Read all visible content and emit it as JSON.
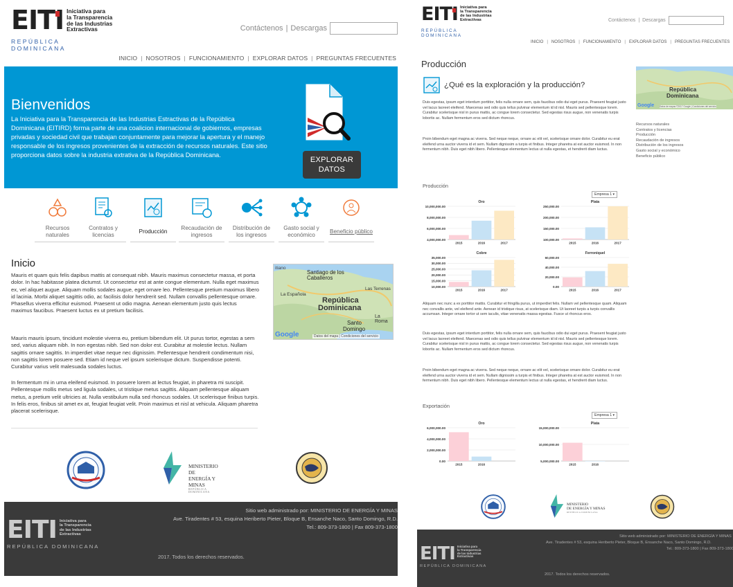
{
  "colors": {
    "hero": "#0097d4",
    "flag_red": "#d02b2b",
    "flag_blue": "#2f5fa8",
    "footer": "#3a3a3a"
  },
  "logo": {
    "big": "EITI",
    "small": [
      "Iniciativa para",
      "la Transparencia",
      "de las Industrias",
      "Extractivas"
    ],
    "country": "REPÚBLICA DOMINICANA"
  },
  "header": {
    "contact": "Contáctenos",
    "separator": "|",
    "downloads": "Descargas"
  },
  "nav": [
    "INICIO",
    "NOSOTROS",
    "FUNCIONAMIENTO",
    "EXPLORAR DATOS",
    "PREGUNTAS FRECUENTES"
  ],
  "hero": {
    "title": "Bienvenidos",
    "text": "La Iniciativa para la Transparencia de las Industrias Estractivas de la República Dominicana (EITIRD) forma parte de una coalicion internacional de gobiernos, empresas privadas y sociedad civil que trabajan conjuntamente para mejorar la apertura y el manejo responsable de los ingresos provenientes de la extracción de recursos naturales. Este sitio proporciona datos sobre la industria extrativa de la República Dominicana.",
    "button": [
      "EXPLORAR",
      "DATOS"
    ],
    "icon": "document-search-icon"
  },
  "categories": [
    {
      "label": "Recursos naturales",
      "icon": "minerals-icon"
    },
    {
      "label": "Contratos y licencias",
      "icon": "contract-icon"
    },
    {
      "label": "Producción",
      "icon": "production-icon"
    },
    {
      "label": "Recaudación de ingresos",
      "icon": "revenue-icon"
    },
    {
      "label": "Distribución de los ingresos",
      "icon": "distribution-icon"
    },
    {
      "label": "Gasto social y económico",
      "icon": "social-spending-icon"
    },
    {
      "label": "Beneficio público",
      "icon": "public-benefit-icon"
    }
  ],
  "inicio": {
    "title": "Inicio",
    "paragraphs": [
      "Mauris et quam quis felis dapibus mattis at consequat nibh. Mauris maximus consectetur massa, et porta dolor. In hac habitasse platea dictumst. Ut consectetur est at ante congue elementum. Nulla eget maximus ex, vel aliquet augue. Aliquam mollis sodales augue, eget ornare leo. Pellentesque pretium maximus libero id lacinia. Morbi aliquet sagittis odio, ac facilisis dolor hendrerit sed. Nullam convallis pellentesque ornare. Phasellus viverra efficitur euismod. Praesent ut odio magna. Aenean elementum justo quis lectus maximus faucibus. Praesent luctus ex ut pretium facilisis.",
      "Mauris mauris ipsum, tincidunt molestie viverra eu, pretium bibendum elit. Ut purus tortor, egestas a sem sed, varius aliquam nibh. In non egestas nibh. Sed non dolor est. Curabitur at molestie lectus. Nullam sagittis ornare sagittis. In imperdiet vitae neque nec dignissim. Pellentesque hendrerit condimentum nisi, non sagittis lorem posuere sed. Etiam id neque vel ipsum scelerisque dictum. Suspendisse potenti. Curabitur varius velit malesuada sodales luctus.",
      "In fermentum mi in urna eleifend euismod. In posuere lorem at lectus feugiat, in pharetra mi suscipit. Pellentesque mollis metus sed ligula sodales, ut tristique metus sagittis. Aliquam pellentesque aliquam metus, a pretium velit ultricies at. Nulla vestibulum nulla sed rhoncus sodales. Ut scelerisque finibus turpis. In felis eros, finibus sit amet ex at, feugiat feugiat velit. Proin maximus et nisl at vehicula. Aliquam pharetra placerat scelerisque."
    ]
  },
  "map": {
    "labels": [
      "Santiago de los Caballeros",
      "Las Terrenas",
      "La Española",
      "República",
      "Dominicana",
      "Santo",
      "Domingo",
      "La Roma"
    ],
    "google": "Google",
    "footer": "Datos del mapa  |  Condiciones del servicio",
    "footer_small": "Datos de mapas ©2017 Google  |  Condiciones del servicio"
  },
  "partners": [
    {
      "name": "seal-one-icon"
    },
    {
      "name": "ministerio-logo",
      "text": [
        "MINISTERIO",
        "DE ENERGÍA Y MINAS",
        "REPÚBLICA DOMINICANA"
      ]
    },
    {
      "name": "seal-two-icon"
    }
  ],
  "footer": {
    "admin": "Sitio web administrado por: MINISTERIO DE ENERGÍA Y MINAS",
    "address": "Ave. Tiradentes # 53, esquina Heriberto Pieter, Bloque B, Ensanche Naco, Santo Domingo, R.D.",
    "phone": "Tel.: 809-373-1800 | Fax 809-373-1800",
    "copyright": "2017. Todos los derechos reservados."
  },
  "production_page": {
    "title": "Producción",
    "question": "¿Qué es la exploración y la producción?",
    "para1": "Duis egestas, ipsum eget interdum porttitor, felis nulla ornare sem, quis faucibus odio dui eget purus. Praesent feugiat justo vel lacus laoreet eleifend. Maecenas sed odio quis tellus pulvinar elementum id id nisl. Mauris sed pellentesque lorem. Curabitur scelerisque nisl in purus mattis, ac congue lorem consectetur. Sed egestas risus augue, non venenatis turpis lobortis ac. Nullam fermentum eros sed dictum rhoncus.",
    "para2": "Proin bibendum eget magna ac viverra. Sed neque neque, ornare ac elit vel, scelerisque ornare dolor. Curabitur eu erat eleifend urna auctor viverra id et sem. Nullam dignissim a turpis et finibus. Integer pharetra at est auctor euismod. In non fermentum nibh. Duis eget nibh libero. Pellentesque elementum lectus ut nulla egestas, et hendrerit diam luctus.",
    "para3": "Aliquam nec nunc a ex porttitor mattis. Curabitur et fringilla purus, ut imperdiet felis. Nullam vel pellentesque quam. Aliquam nec convallis ante, vel eleifend ante. Aenean id tristique risus, at scelerisque diam. Ut laoreet turpis a turpis convallis accumsan. Integer ornare tortor ut sem iaculis, vitae venenatis massa egestas. Fusce ut rhoncus eros.",
    "para4": "Duis egestas, ipsum eget interdum porttitor, felis nulla ornare sem, quis faucibus odio dui eget purus. Praesent feugiat justo vel lacus laoreet eleifend. Maecenas sed odio quis tellus pulvinar elementum id id nisl. Mauris sed pellentesque lorem. Curabitur scelerisque nisl in purus mattis, ac congue lorem consectetur. Sed egestas risus augue, non venenatis turpis lobortis ac. Nullam fermentum eros sed dictum rhoncus.",
    "para5": "Proin bibendum eget magna ac viverra. Sed neque neque, ornare ac elit vel, scelerisque ornare dolor. Curabitur eu erat eleifend urna auctor viverra id et sem. Nullam dignissim a turpis et finibus. Integer pharetra at est auctor euismod. In non fermentum nibh. Duis eget nibh libero. Pellentesque elementum lectus ut nulla egestas, et hendrerit diam luctus.",
    "side_links": [
      "Recursos naturales",
      "Contratos y licencias",
      "Producción",
      "Recaudación de ingresos",
      "Distribución de los ingresos",
      "Gasto social y económico",
      "Beneficio público"
    ],
    "section_production": "Producción",
    "section_export": "Exportación",
    "select": "Empresa 1 ▾"
  },
  "chart_data": [
    {
      "type": "bar",
      "title": "Oro",
      "categories": [
        "2015",
        "2016",
        "2017"
      ],
      "values": [
        4800000,
        7400000,
        9200000
      ],
      "ylim": [
        4000000,
        10000000
      ],
      "yticks": [
        "4,000,000.00",
        "6,000,000.00",
        "8,000,000.00",
        "10,000,000.00"
      ],
      "colors": [
        "#fcd0d8",
        "#c6e2f5",
        "#fde9c4"
      ]
    },
    {
      "type": "bar",
      "title": "Plata",
      "categories": [
        "2015",
        "2016",
        "2017"
      ],
      "values": [
        105000,
        155000,
        250000
      ],
      "ylim": [
        100000,
        250000
      ],
      "yticks": [
        "100,000.00",
        "150,000.00",
        "200,000.00",
        "250,000.00"
      ],
      "colors": [
        "#fcd0d8",
        "#c6e2f5",
        "#fde9c4"
      ]
    },
    {
      "type": "bar",
      "title": "Cobre",
      "categories": [
        "2015",
        "2016",
        "2017"
      ],
      "values": [
        14000000,
        24000000,
        33000000
      ],
      "ylim": [
        10000000,
        35000000
      ],
      "yticks": [
        "10,000.00",
        "15,000.00",
        "20,000.00",
        "25,000.00",
        "30,000.00",
        "35,000.00"
      ],
      "colors": [
        "#fcd0d8",
        "#c6e2f5",
        "#fde9c4"
      ]
    },
    {
      "type": "bar",
      "title": "Ferroniquel",
      "categories": [
        "2015",
        "2016",
        "2017"
      ],
      "values": [
        19000,
        32000,
        47000
      ],
      "ylim": [
        0,
        60000
      ],
      "yticks": [
        "0.00",
        "20,000.00",
        "40,000.00",
        "60,000.00"
      ],
      "colors": [
        "#fcd0d8",
        "#c6e2f5",
        "#fde9c4"
      ]
    },
    {
      "type": "bar",
      "title": "Oro",
      "categories": [
        "2015",
        "2016"
      ],
      "values": [
        5200000,
        800000
      ],
      "ylim": [
        0,
        6000000
      ],
      "yticks": [
        "0.00",
        "2,000,000.00",
        "4,000,000.00",
        "6,000,000.00"
      ],
      "colors": [
        "#fcd0d8",
        "#c6e2f5"
      ]
    },
    {
      "type": "bar",
      "title": "Plata",
      "categories": [
        "2015",
        "2016"
      ],
      "values": [
        10500000,
        4600000
      ],
      "ylim": [
        5000000,
        15000000
      ],
      "yticks": [
        "5,000,000.00",
        "10,000,000.00",
        "15,000,000.00"
      ],
      "colors": [
        "#fcd0d8",
        "#c6e2f5"
      ]
    }
  ]
}
